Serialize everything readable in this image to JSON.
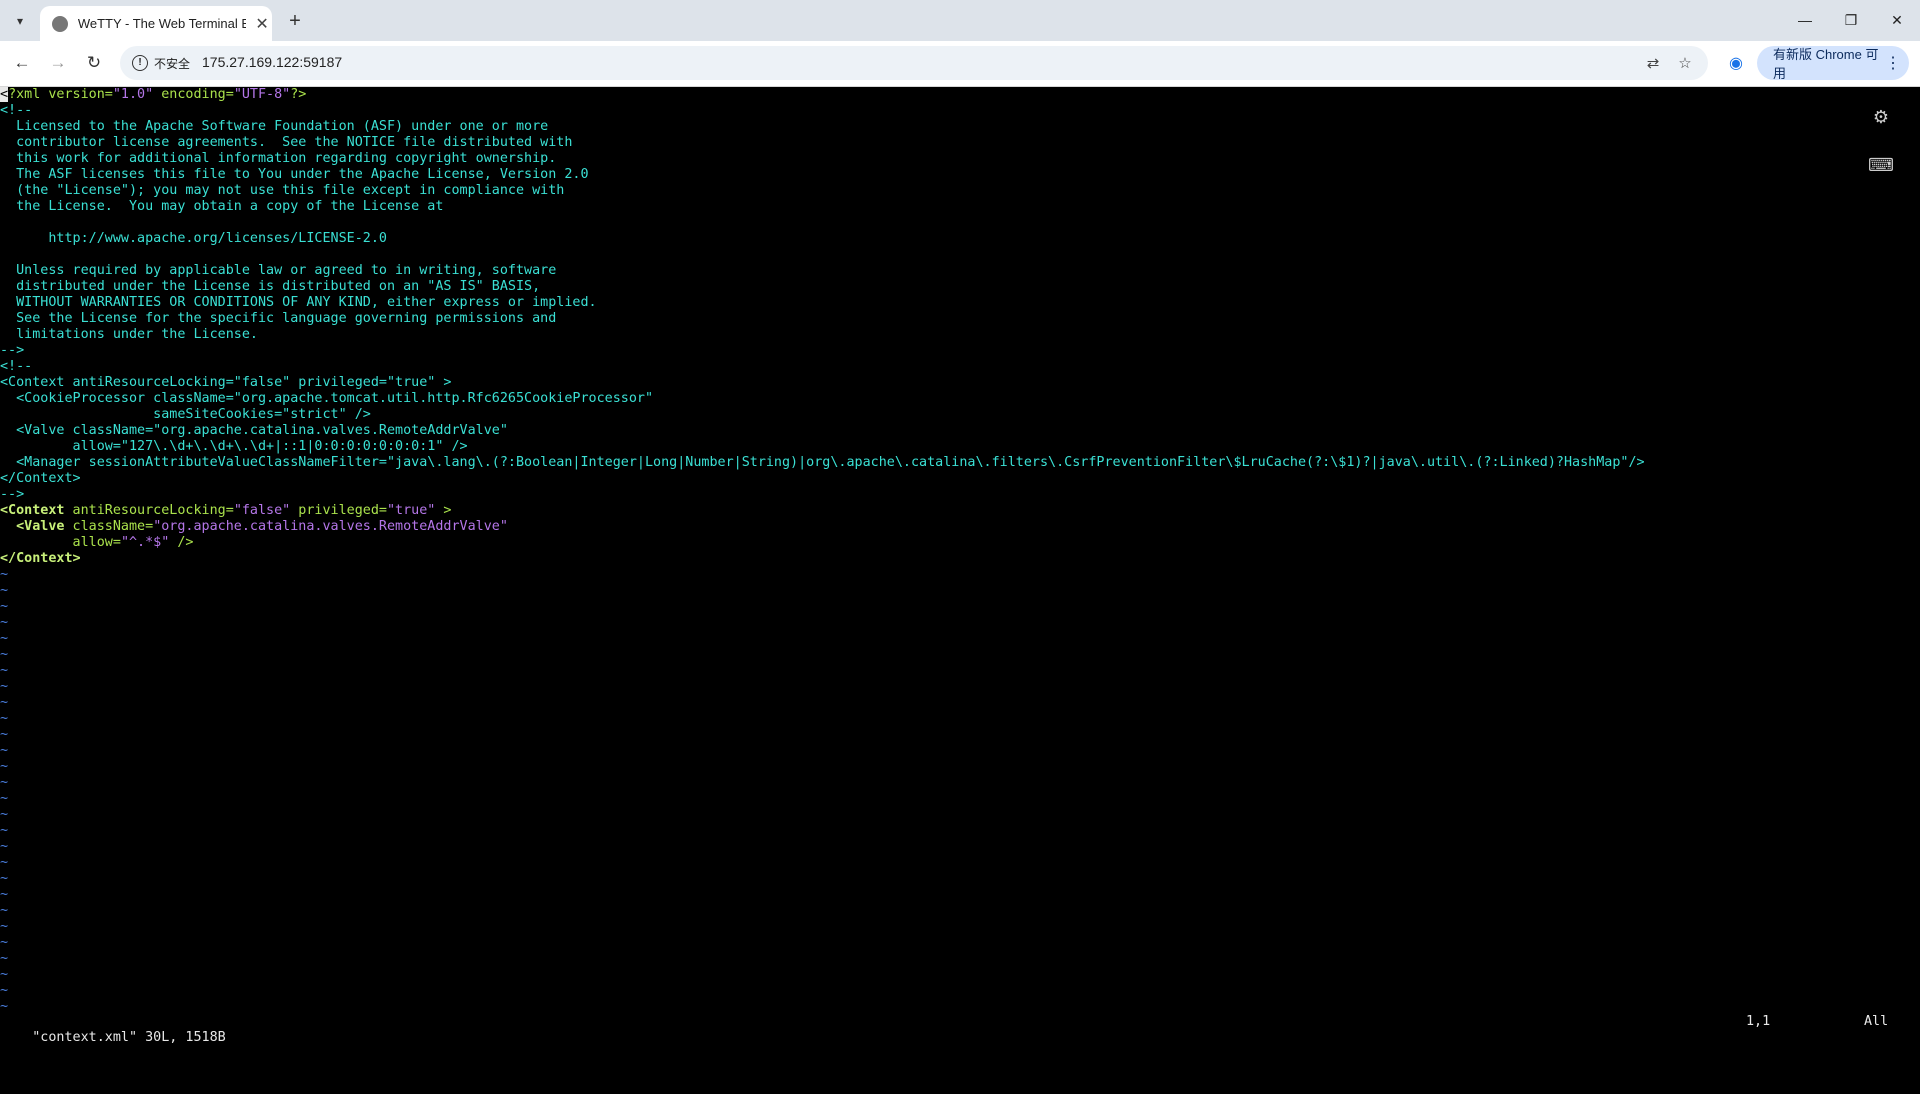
{
  "browser": {
    "tab_title": "WeTTY - The Web Terminal E",
    "new_tab_symbol": "+",
    "tab_close_symbol": "✕",
    "security_label": "不安全",
    "url": "175.27.169.122:59187",
    "update_label": "有新版 Chrome 可用",
    "window_minimize": "—",
    "window_restore": "❐",
    "window_close": "✕"
  },
  "terminal": {
    "lines": [
      {
        "segs": [
          {
            "t": "<",
            "c": "cursor"
          },
          {
            "t": "?xml version=",
            "c": "t-green"
          },
          {
            "t": "\"1.0\"",
            "c": "t-purple"
          },
          {
            "t": " encoding=",
            "c": "t-green"
          },
          {
            "t": "\"UTF-8\"",
            "c": "t-purple"
          },
          {
            "t": "?>",
            "c": "t-green"
          }
        ]
      },
      {
        "segs": [
          {
            "t": "<!--",
            "c": "t-cyan"
          }
        ]
      },
      {
        "segs": [
          {
            "t": "  Licensed to the Apache Software Foundation (ASF) under one or more",
            "c": "t-cyan"
          }
        ]
      },
      {
        "segs": [
          {
            "t": "  contributor license agreements.  See the NOTICE file distributed with",
            "c": "t-cyan"
          }
        ]
      },
      {
        "segs": [
          {
            "t": "  this work for additional information regarding copyright ownership.",
            "c": "t-cyan"
          }
        ]
      },
      {
        "segs": [
          {
            "t": "  The ASF licenses this file to You under the Apache License, Version 2.0",
            "c": "t-cyan"
          }
        ]
      },
      {
        "segs": [
          {
            "t": "  (the \"License\"); you may not use this file except in compliance with",
            "c": "t-cyan"
          }
        ]
      },
      {
        "segs": [
          {
            "t": "  the License.  You may obtain a copy of the License at",
            "c": "t-cyan"
          }
        ]
      },
      {
        "segs": [
          {
            "t": "",
            "c": "t-cyan"
          }
        ]
      },
      {
        "segs": [
          {
            "t": "      http://www.apache.org/licenses/LICENSE-2.0",
            "c": "t-cyan"
          }
        ]
      },
      {
        "segs": [
          {
            "t": "",
            "c": "t-cyan"
          }
        ]
      },
      {
        "segs": [
          {
            "t": "  Unless required by applicable law or agreed to in writing, software",
            "c": "t-cyan"
          }
        ]
      },
      {
        "segs": [
          {
            "t": "  distributed under the License is distributed on an \"AS IS\" BASIS,",
            "c": "t-cyan"
          }
        ]
      },
      {
        "segs": [
          {
            "t": "  WITHOUT WARRANTIES OR CONDITIONS OF ANY KIND, either express or implied.",
            "c": "t-cyan"
          }
        ]
      },
      {
        "segs": [
          {
            "t": "  See the License for the specific language governing permissions and",
            "c": "t-cyan"
          }
        ]
      },
      {
        "segs": [
          {
            "t": "  limitations under the License.",
            "c": "t-cyan"
          }
        ]
      },
      {
        "segs": [
          {
            "t": "-->",
            "c": "t-cyan"
          }
        ]
      },
      {
        "segs": [
          {
            "t": "<!--",
            "c": "t-cyan"
          }
        ]
      },
      {
        "segs": [
          {
            "t": "<Context antiResourceLocking=\"false\" privileged=\"true\" >",
            "c": "t-cyan"
          }
        ]
      },
      {
        "segs": [
          {
            "t": "  <CookieProcessor className=\"org.apache.tomcat.util.http.Rfc6265CookieProcessor\"",
            "c": "t-cyan"
          }
        ]
      },
      {
        "segs": [
          {
            "t": "                   sameSiteCookies=\"strict\" />",
            "c": "t-cyan"
          }
        ]
      },
      {
        "segs": [
          {
            "t": "  <Valve className=\"org.apache.catalina.valves.RemoteAddrValve\"",
            "c": "t-cyan"
          }
        ]
      },
      {
        "segs": [
          {
            "t": "         allow=\"127\\.\\d+\\.\\d+\\.\\d+|::1|0:0:0:0:0:0:0:1\" />",
            "c": "t-cyan"
          }
        ]
      },
      {
        "segs": [
          {
            "t": "  <Manager sessionAttributeValueClassNameFilter=\"java\\.lang\\.(?:Boolean|Integer|Long|Number|String)|org\\.apache\\.catalina\\.filters\\.CsrfPreventionFilter\\$LruCache(?:\\$1)?|java\\.util\\.(?:Linked)?HashMap\"/>",
            "c": "t-cyan"
          }
        ]
      },
      {
        "segs": [
          {
            "t": "</Context>",
            "c": "t-cyan"
          }
        ]
      },
      {
        "segs": [
          {
            "t": "-->",
            "c": "t-cyan"
          }
        ]
      },
      {
        "segs": [
          {
            "t": "<Context",
            "c": "t-green-bold"
          },
          {
            "t": " antiResourceLocking=",
            "c": "t-green"
          },
          {
            "t": "\"false\"",
            "c": "t-purple"
          },
          {
            "t": " privileged=",
            "c": "t-green"
          },
          {
            "t": "\"true\"",
            "c": "t-purple"
          },
          {
            "t": " >",
            "c": "t-green"
          }
        ]
      },
      {
        "segs": [
          {
            "t": "  <Valve",
            "c": "t-green-bold"
          },
          {
            "t": " className=",
            "c": "t-green"
          },
          {
            "t": "\"org.apache.catalina.valves.RemoteAddrValve\"",
            "c": "t-purple"
          }
        ]
      },
      {
        "segs": [
          {
            "t": "         allow=",
            "c": "t-green"
          },
          {
            "t": "\"^.*$\"",
            "c": "t-purple"
          },
          {
            "t": " />",
            "c": "t-green"
          }
        ]
      },
      {
        "segs": [
          {
            "t": "</Context>",
            "c": "t-green-bold"
          }
        ]
      }
    ],
    "tilde": "~",
    "tilde_count": 28,
    "status_file": "\"context.xml\" 30L, 1518B",
    "status_pos": "1,1",
    "status_all": "All"
  },
  "colors": {
    "cyan": "#3ae0d4",
    "green": "#aae24c",
    "purple": "#b476e8",
    "tilde": "#4a7fe0"
  },
  "icons": {
    "settings": "gears-icon",
    "keyboard": "keyboard-icon"
  }
}
